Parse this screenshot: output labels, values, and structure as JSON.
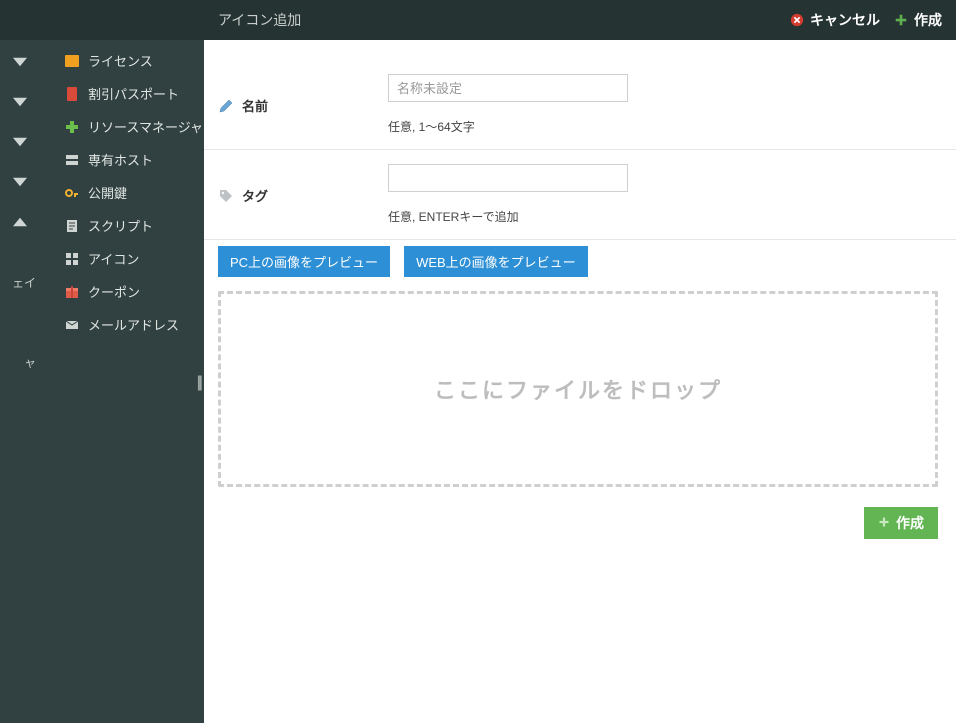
{
  "topbar": {
    "title": "アイコン追加",
    "cancel_label": "キャンセル",
    "create_label": "作成"
  },
  "rail": {
    "text1": "ェイ",
    "text2": "ャ"
  },
  "sidebar": {
    "items": [
      {
        "label": "ライセンス",
        "icon": "license-icon",
        "color": "#f0a020"
      },
      {
        "label": "割引パスポート",
        "icon": "passport-icon",
        "color": "#d84a3a"
      },
      {
        "label": "リソースマネージャ",
        "icon": "resource-icon",
        "color": "#6bbf4a"
      },
      {
        "label": "専有ホスト",
        "icon": "host-icon",
        "color": "#cfd3d2"
      },
      {
        "label": "公開鍵",
        "icon": "key-icon",
        "color": "#f0b030"
      },
      {
        "label": "スクリプト",
        "icon": "script-icon",
        "color": "#cfd3d2"
      },
      {
        "label": "アイコン",
        "icon": "grid-icon",
        "color": "#cfd3d2"
      },
      {
        "label": "クーポン",
        "icon": "coupon-icon",
        "color": "#e05a4a"
      },
      {
        "label": "メールアドレス",
        "icon": "mail-icon",
        "color": "#cfd3d2"
      }
    ]
  },
  "form": {
    "name": {
      "label": "名前",
      "placeholder": "名称未設定",
      "help": "任意, 1〜64文字"
    },
    "tag": {
      "label": "タグ",
      "placeholder": "",
      "help": "任意, ENTERキーで追加"
    }
  },
  "buttons": {
    "preview_pc": "PC上の画像をプレビュー",
    "preview_web": "WEB上の画像をプレビュー"
  },
  "dropzone": {
    "label": "ここにファイルをドロップ"
  },
  "footer": {
    "create_label": "作成"
  }
}
